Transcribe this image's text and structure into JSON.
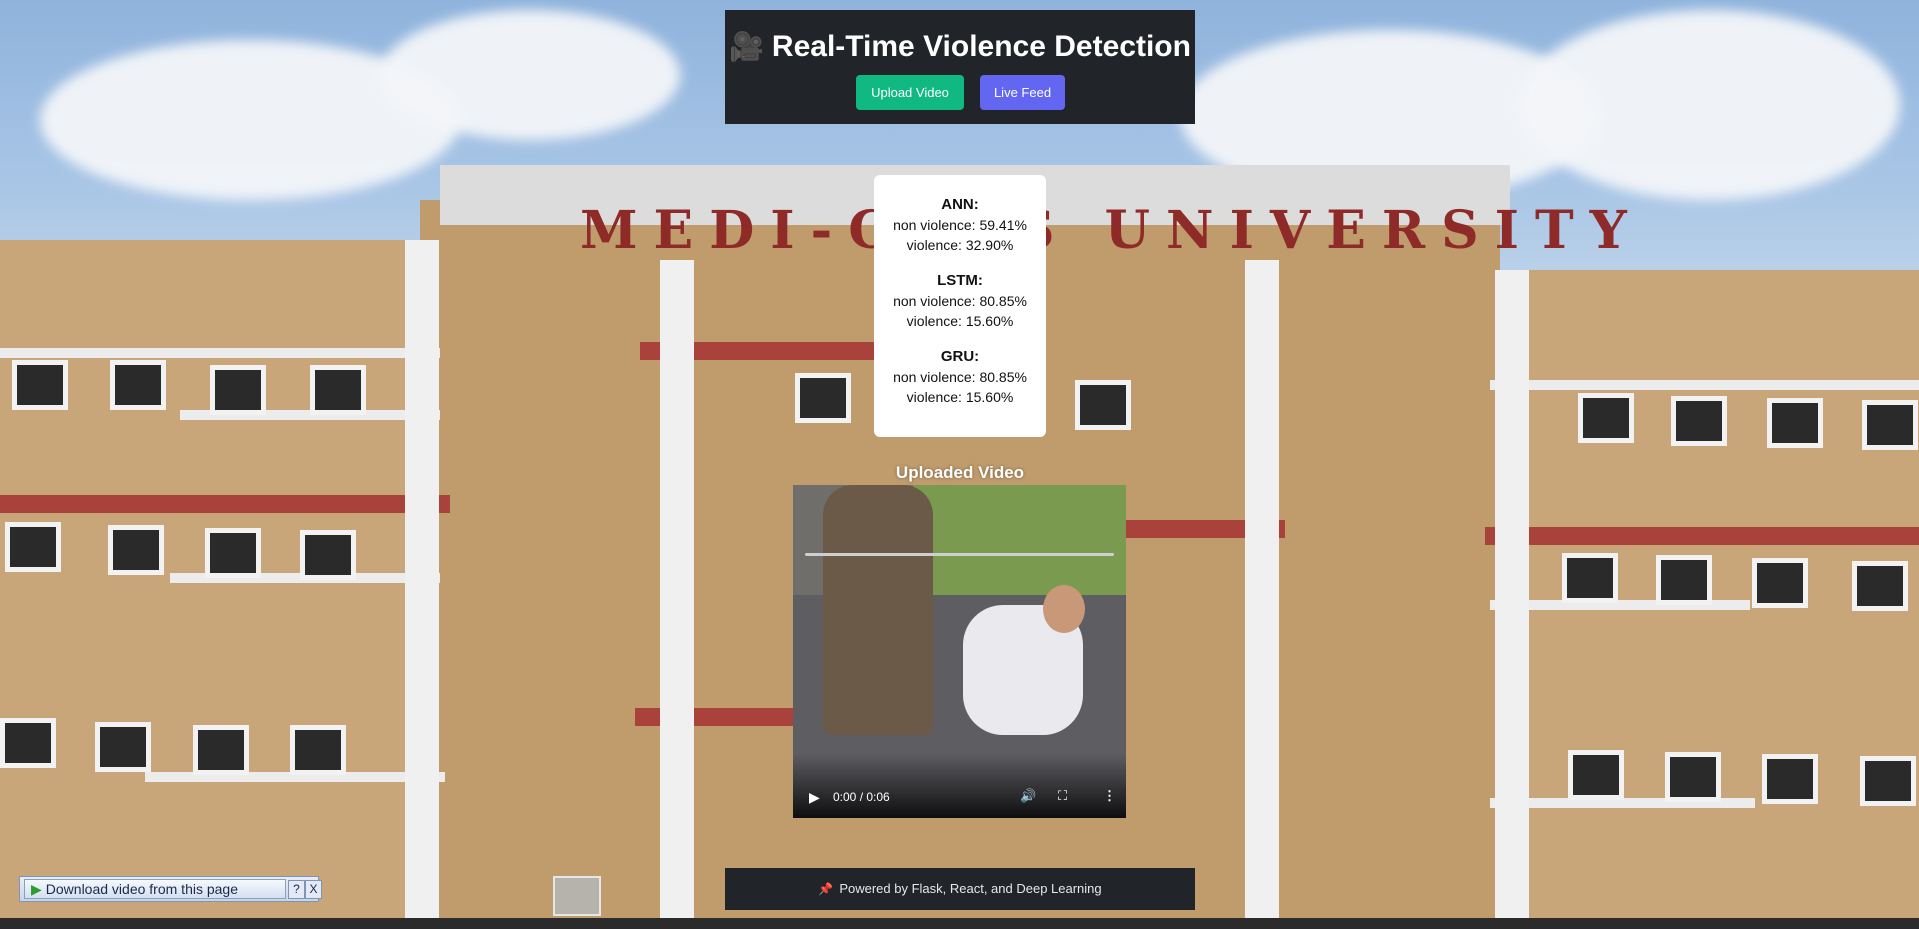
{
  "header": {
    "title": "Real-Time Violence Detection",
    "upload_button": "Upload Video",
    "live_button": "Live Feed"
  },
  "background": {
    "sign_text": "MEDI-CAPS UNIVERSITY"
  },
  "results": [
    {
      "model": "ANN:",
      "non_violence": "non violence: 59.41%",
      "violence": "violence: 32.90%"
    },
    {
      "model": "LSTM:",
      "non_violence": "non violence: 80.85%",
      "violence": "violence: 15.60%"
    },
    {
      "model": "GRU:",
      "non_violence": "non violence: 80.85%",
      "violence": "violence: 15.60%"
    }
  ],
  "video": {
    "label": "Uploaded Video",
    "time": "0:00 / 0:06"
  },
  "footer": {
    "text": "Powered by Flask, React, and Deep Learning"
  },
  "download_toolbar": {
    "label": "Download video from this page",
    "help": "?",
    "close": "X"
  },
  "colors": {
    "panel": "#212529",
    "upload_button": "#10b981",
    "live_button": "#6366f1"
  },
  "icons": {
    "header": "camera-icon",
    "footer": "pin-icon",
    "video_play": "play-icon",
    "video_volume": "volume-icon",
    "video_fullscreen": "fullscreen-icon",
    "video_more": "more-options-icon"
  }
}
